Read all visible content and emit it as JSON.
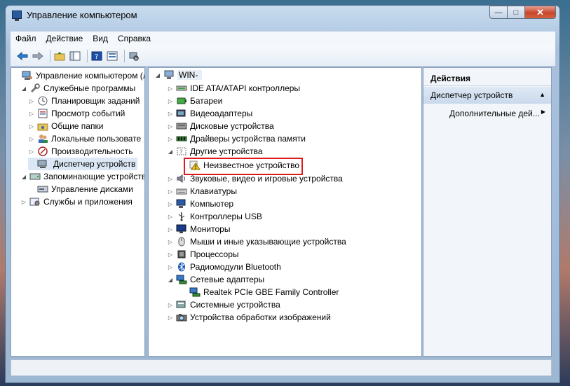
{
  "window": {
    "title": "Управление компьютером"
  },
  "caption": {
    "minimize": "—",
    "maximize": "□",
    "close": "✕"
  },
  "menu": [
    "Файл",
    "Действие",
    "Вид",
    "Справка"
  ],
  "toolbar_icons": [
    "back-arrow-icon",
    "forward-arrow-icon",
    "up-folder-icon",
    "show-tree-icon",
    "help-icon",
    "properties-icon",
    "scan-hardware-icon"
  ],
  "left_tree": [
    {
      "label": "Управление компьютером (л",
      "icon": "computer-management-icon",
      "indent": 0,
      "expander": ""
    },
    {
      "label": "Служебные программы",
      "icon": "tools-icon",
      "indent": 1,
      "expander": "◢"
    },
    {
      "label": "Планировщик заданий",
      "icon": "clock-icon",
      "indent": 2,
      "expander": "▷"
    },
    {
      "label": "Просмотр событий",
      "icon": "event-viewer-icon",
      "indent": 2,
      "expander": "▷"
    },
    {
      "label": "Общие папки",
      "icon": "shared-folders-icon",
      "indent": 2,
      "expander": "▷"
    },
    {
      "label": "Локальные пользовате",
      "icon": "users-icon",
      "indent": 2,
      "expander": "▷"
    },
    {
      "label": "Производительность",
      "icon": "performance-icon",
      "indent": 2,
      "expander": "▷"
    },
    {
      "label": "Диспетчер устройств",
      "icon": "device-manager-icon",
      "indent": 2,
      "expander": "",
      "selected": true
    },
    {
      "label": "Запоминающие устройств",
      "icon": "storage-icon",
      "indent": 1,
      "expander": "◢"
    },
    {
      "label": "Управление дисками",
      "icon": "disk-management-icon",
      "indent": 2,
      "expander": ""
    },
    {
      "label": "Службы и приложения",
      "icon": "services-icon",
      "indent": 1,
      "expander": "▷"
    }
  ],
  "device_tree": {
    "root": "WIN-",
    "items": [
      {
        "label": "IDE ATA/ATAPI контроллеры",
        "icon": "ide-controller-icon",
        "expander": "▷",
        "indent": 1
      },
      {
        "label": "Батареи",
        "icon": "battery-icon",
        "expander": "▷",
        "indent": 1
      },
      {
        "label": "Видеоадаптеры",
        "icon": "display-adapter-icon",
        "expander": "▷",
        "indent": 1
      },
      {
        "label": "Дисковые устройства",
        "icon": "disk-drive-icon",
        "expander": "▷",
        "indent": 1
      },
      {
        "label": "Драйверы устройства памяти",
        "icon": "memory-driver-icon",
        "expander": "▷",
        "indent": 1
      },
      {
        "label": "Другие устройства",
        "icon": "other-devices-icon",
        "expander": "◢",
        "indent": 1
      },
      {
        "label": "Неизвестное устройство",
        "icon": "unknown-device-warning-icon",
        "expander": "",
        "indent": 2,
        "highlighted": true
      },
      {
        "label": "Звуковые, видео и игровые устройства",
        "icon": "sound-icon",
        "expander": "▷",
        "indent": 1
      },
      {
        "label": "Клавиатуры",
        "icon": "keyboard-icon",
        "expander": "▷",
        "indent": 1
      },
      {
        "label": "Компьютер",
        "icon": "computer-icon",
        "expander": "▷",
        "indent": 1
      },
      {
        "label": "Контроллеры USB",
        "icon": "usb-icon",
        "expander": "▷",
        "indent": 1
      },
      {
        "label": "Мониторы",
        "icon": "monitor-icon",
        "expander": "▷",
        "indent": 1
      },
      {
        "label": "Мыши и иные указывающие устройства",
        "icon": "mouse-icon",
        "expander": "▷",
        "indent": 1
      },
      {
        "label": "Процессоры",
        "icon": "processor-icon",
        "expander": "▷",
        "indent": 1
      },
      {
        "label": "Радиомодули Bluetooth",
        "icon": "bluetooth-icon",
        "expander": "▷",
        "indent": 1
      },
      {
        "label": "Сетевые адаптеры",
        "icon": "network-adapter-icon",
        "expander": "◢",
        "indent": 1
      },
      {
        "label": "Realtek PCIe GBE Family Controller",
        "icon": "network-card-icon",
        "expander": "",
        "indent": 2
      },
      {
        "label": "Системные устройства",
        "icon": "system-devices-icon",
        "expander": "▷",
        "indent": 1
      },
      {
        "label": "Устройства обработки изображений",
        "icon": "imaging-devices-icon",
        "expander": "▷",
        "indent": 1
      }
    ]
  },
  "actions": {
    "header": "Действия",
    "section": "Диспетчер устройств",
    "more": "Дополнительные дей..."
  },
  "colors": {
    "highlight_border": "#e01a1a",
    "selection": "#dbe7f5"
  }
}
